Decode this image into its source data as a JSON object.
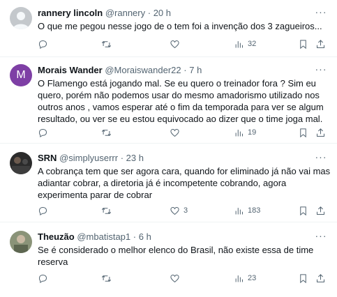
{
  "tweets": [
    {
      "name": "rannery lincoln",
      "handle": "@rannery",
      "time": "20 h",
      "text": "O que me pegou nesse jogo de o tem foi a invenção dos 3 zagueiros...",
      "replies": "",
      "retweets": "",
      "likes": "",
      "views": "32"
    },
    {
      "name": "Morais Wander",
      "handle": "@Moraiswander22",
      "time": "7 h",
      "avatar_letter": "M",
      "text": "O Flamengo está jogando mal. Se eu quero o treinador fora ? Sim eu  quero, porém não podemos usar do mesmo amadorismo utilizado nos outros anos , vamos esperar até o fim da temporada para ver se algum resultado, ou ver se eu estou equivocado ao dizer que o time joga mal.",
      "replies": "",
      "retweets": "",
      "likes": "",
      "views": "19"
    },
    {
      "name": "SRN",
      "handle": "@simplyuserrr",
      "time": "23 h",
      "text": "A cobrança tem que ser agora cara, quando for eliminado já não vai mas adiantar cobrar, a diretoria já é incompetente cobrando, agora experimenta parar de cobrar",
      "replies": "",
      "retweets": "",
      "likes": "3",
      "views": "183"
    },
    {
      "name": "Theuzão",
      "handle": "@mbatistap1",
      "time": "6 h",
      "text": "Se é considerado o melhor elenco do Brasil, não existe essa de time reserva",
      "replies": "",
      "retweets": "",
      "likes": "",
      "views": "23"
    }
  ],
  "separator": "·",
  "more_glyph": "···",
  "colors": {
    "text": "#0f1419",
    "secondary": "#536471",
    "border": "#eff3f4",
    "avatar_m": "#7e3fa5"
  },
  "icons": [
    "reply-icon",
    "retweet-icon",
    "like-icon",
    "views-icon",
    "bookmark-icon",
    "share-icon",
    "more-icon"
  ]
}
